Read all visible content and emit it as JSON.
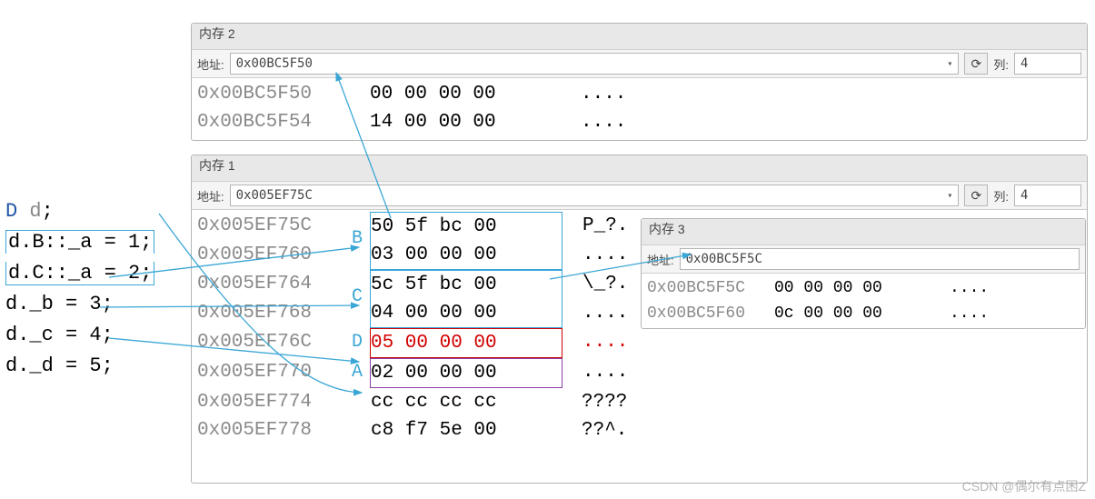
{
  "code": {
    "decl_type": "D",
    "decl_var": "d",
    "a1": "d.B::_a = 1;",
    "a2": "d.C::_a = 2;",
    "b": "d._b = 3;",
    "c": "d._c = 4;",
    "d": "d._d = 5;"
  },
  "mem2": {
    "title": "内存 2",
    "addr_label": "地址:",
    "address": "0x00BC5F50",
    "cols_label": "列:",
    "cols": "4",
    "rows": [
      {
        "addr": "0x00BC5F50",
        "bytes": "00 00 00 00",
        "ascii": "...."
      },
      {
        "addr": "0x00BC5F54",
        "bytes": "14 00 00 00",
        "ascii": "...."
      }
    ]
  },
  "mem1": {
    "title": "内存 1",
    "addr_label": "地址:",
    "address": "0x005EF75C",
    "cols_label": "列:",
    "cols": "4",
    "rows": [
      {
        "addr": "0x005EF75C",
        "tag": "B",
        "bytes": "50 5f bc 00",
        "ascii": "P_?."
      },
      {
        "addr": "0x005EF760",
        "tag": "",
        "bytes": "03 00 00 00",
        "ascii": "...."
      },
      {
        "addr": "0x005EF764",
        "tag": "C",
        "bytes": "5c 5f bc 00",
        "ascii": "\\_?."
      },
      {
        "addr": "0x005EF768",
        "tag": "",
        "bytes": "04 00 00 00",
        "ascii": "...."
      },
      {
        "addr": "0x005EF76C",
        "tag": "D",
        "bytes": "05 00 00 00",
        "ascii": "...."
      },
      {
        "addr": "0x005EF770",
        "tag": "A",
        "bytes": "02 00 00 00",
        "ascii": "...."
      },
      {
        "addr": "0x005EF774",
        "tag": "",
        "bytes": "cc cc cc cc",
        "ascii": "????"
      },
      {
        "addr": "0x005EF778",
        "tag": "",
        "bytes": "c8 f7 5e 00",
        "ascii": "??^."
      }
    ]
  },
  "mem3": {
    "title": "内存 3",
    "addr_label": "地址:",
    "address": "0x00BC5F5C",
    "rows": [
      {
        "addr": "0x00BC5F5C",
        "bytes": "00 00 00 00",
        "ascii": "...."
      },
      {
        "addr": "0x00BC5F60",
        "bytes": "0c 00 00 00",
        "ascii": "...."
      }
    ]
  },
  "watermark": "CSDN @偶尔有点困Z"
}
